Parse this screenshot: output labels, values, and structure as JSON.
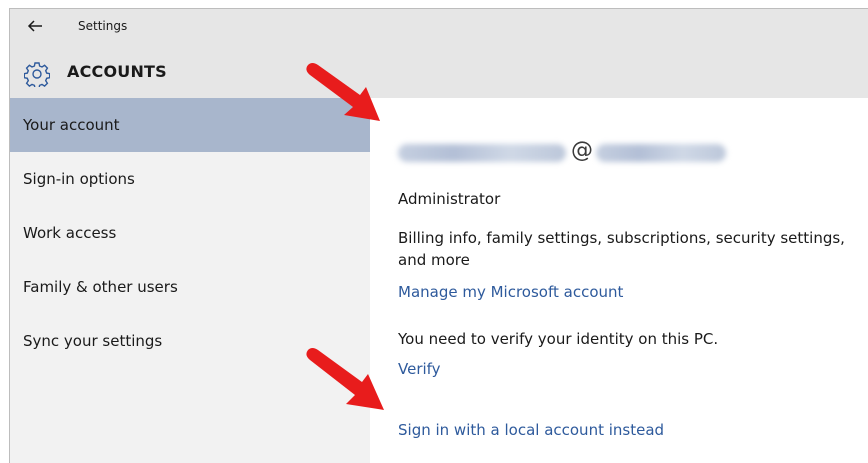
{
  "window": {
    "back_icon": "back-arrow-icon",
    "title": "Settings"
  },
  "header": {
    "icon": "gear-icon",
    "title": "ACCOUNTS"
  },
  "sidebar": {
    "items": [
      {
        "label": "Your account",
        "selected": true
      },
      {
        "label": "Sign-in options",
        "selected": false
      },
      {
        "label": "Work access",
        "selected": false
      },
      {
        "label": "Family & other users",
        "selected": false
      },
      {
        "label": "Sync your settings",
        "selected": false
      }
    ]
  },
  "account": {
    "email_visible_part": "@",
    "role": "Administrator",
    "billing_text": "Billing info, family settings, subscriptions, security settings, and more",
    "manage_link": "Manage my Microsoft account",
    "verify_text": "You need to verify your identity on this PC.",
    "verify_link": "Verify",
    "local_account_link": "Sign in with a local account instead"
  },
  "colors": {
    "selected_nav": "#a8b6cc",
    "link": "#2e5a9c",
    "annotation_arrow": "#e81c1c"
  }
}
